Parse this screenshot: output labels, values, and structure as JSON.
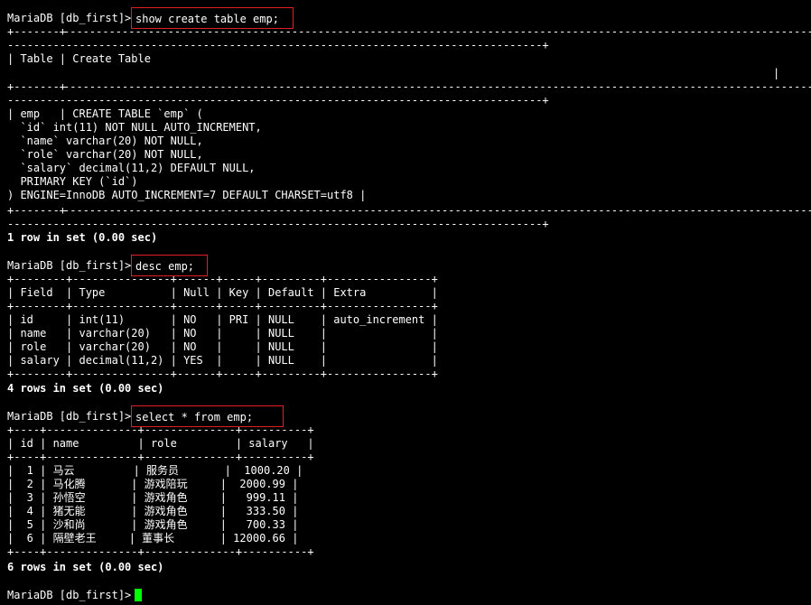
{
  "prompt": "MariaDB [db_first]>",
  "highlight_color": "#e02020",
  "cursor_color": "#00ff00",
  "commands": [
    "show create table emp;",
    "desc emp;",
    "select * from emp;"
  ],
  "create_table_result": {
    "border_top_left": "+-------+",
    "border_long": "---------------------------------------------------------------------------------------------------------------------------------------------",
    "border_wrap_end": "----------------------------------------------------------------------------------+",
    "header_row": "| Table | Create Table",
    "header_wrap_end": "|",
    "data_lines": [
      "| emp   | CREATE TABLE `emp` (",
      "  `id` int(11) NOT NULL AUTO_INCREMENT,",
      "  `name` varchar(20) NOT NULL,",
      "  `role` varchar(20) NOT NULL,",
      "  `salary` decimal(11,2) DEFAULT NULL,",
      "  PRIMARY KEY (`id`)",
      ") ENGINE=InnoDB AUTO_INCREMENT=7 DEFAULT CHARSET=utf8 |"
    ],
    "status": "1 row in set (0.00 sec)"
  },
  "desc_result": {
    "border": "+--------+---------------+------+-----+---------+----------------+",
    "header": "| Field  | Type          | Null | Key | Default | Extra          |",
    "rows": [
      "| id     | int(11)       | NO   | PRI | NULL    | auto_increment |",
      "| name   | varchar(20)   | NO   |     | NULL    |                |",
      "| role   | varchar(20)   | NO   |     | NULL    |                |",
      "| salary | decimal(11,2) | YES  |     | NULL    |                |"
    ],
    "status": "4 rows in set (0.00 sec)"
  },
  "select_result": {
    "border": "+----+--------------+--------------+----------+",
    "header": "| id | name         | role         | salary   |",
    "rows": [
      "|  1 | 马云         | 服务员       |  1000.20 |",
      "|  2 | 马化腾       | 游戏陪玩     |  2000.99 |",
      "|  3 | 孙悟空       | 游戏角色     |   999.11 |",
      "|  4 | 猪无能       | 游戏角色     |   333.50 |",
      "|  5 | 沙和尚       | 游戏角色     |   700.33 |",
      "|  6 | 隔壁老王     | 董事长       | 12000.66 |"
    ],
    "status": "6 rows in set (0.00 sec)"
  }
}
